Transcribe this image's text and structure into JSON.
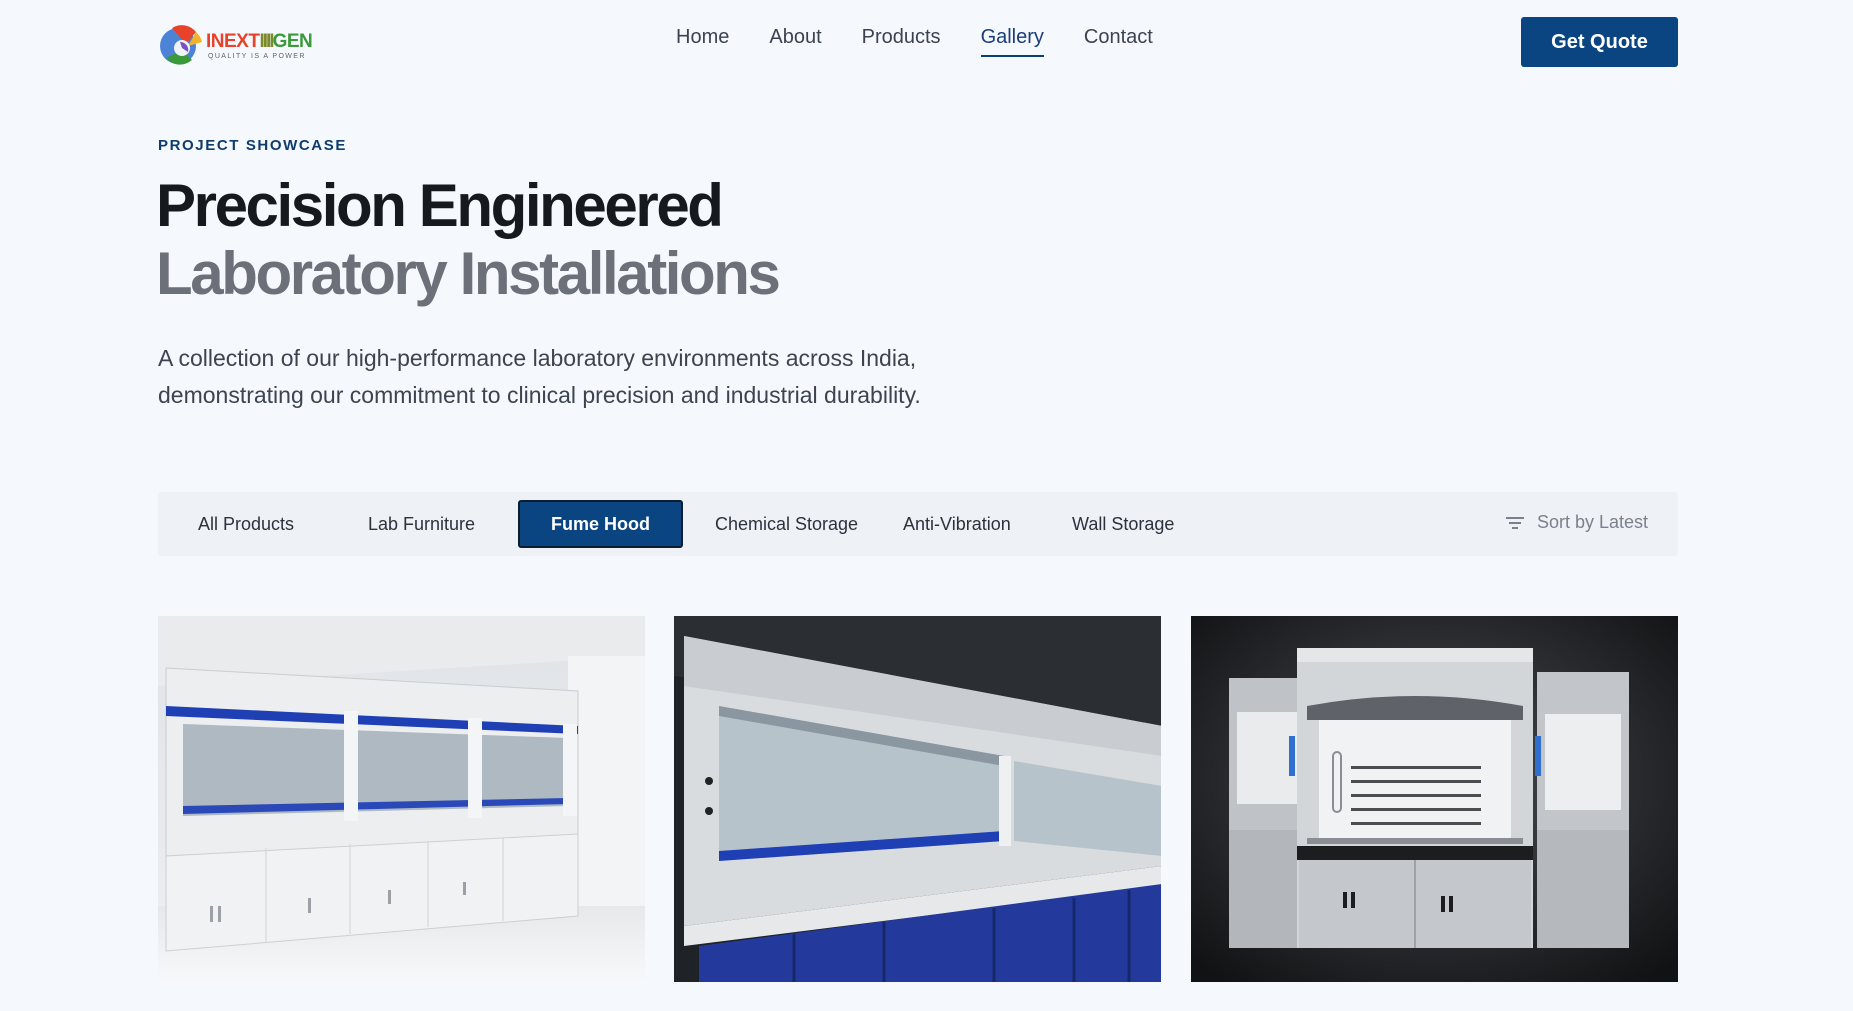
{
  "brand": {
    "name_part1": "INEXT",
    "name_bars": "IIII",
    "name_part2": "GEN",
    "tagline": "QUALITY IS A POWER"
  },
  "nav": {
    "items": [
      "Home",
      "About",
      "Products",
      "Gallery",
      "Contact"
    ],
    "active": "Gallery",
    "cta": "Get Quote"
  },
  "hero": {
    "eyebrow": "PROJECT SHOWCASE",
    "title_line1": "Precision Engineered",
    "title_line2": "Laboratory Installations",
    "lead": "A collection of our high-performance laboratory environments across India, demonstrating our commitment to clinical precision and industrial durability."
  },
  "filters": {
    "items": [
      "All Products",
      "Lab Furniture",
      "Fume Hood",
      "Chemical Storage",
      "Anti-Vibration",
      "Wall Storage"
    ],
    "active": "Fume Hood",
    "sort_label": "Sort by Latest"
  },
  "colors": {
    "primary": "#0a4582",
    "background": "#f5f8fc",
    "accent_blue": "#1f3fb5"
  }
}
